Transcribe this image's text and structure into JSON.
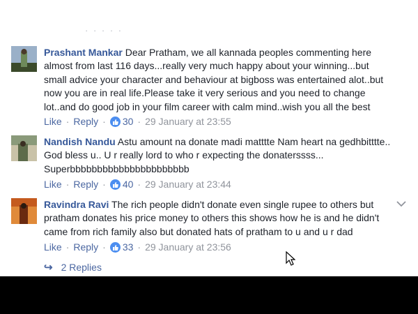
{
  "comments": [
    {
      "author": "Prashant Mankar",
      "text": "Dear Pratham, we all kannada peoples commenting here almost from last 116 days...really very much happy about your winning...but small advice your character and behaviour at bigboss was entertained alot..but now you are in real life.Please take it very serious and you need to change lot..and do good job in your film career with calm mind..wish you all the best",
      "like_label": "Like",
      "reply_label": "Reply",
      "likes": "30",
      "time": "29 January at 23:55",
      "avatar_colors": [
        "#9ab0c8",
        "#6e8a5a",
        "#3b4a2a"
      ]
    },
    {
      "author": "Nandish Nandu",
      "text": "Astu amount na donate madi matttte Nam heart na gedhbitttte.. God bless u.. U r really lord to who r expecting the donaterssss... Superbbbbbbbbbbbbbbbbbbbbbb",
      "like_label": "Like",
      "reply_label": "Reply",
      "likes": "40",
      "time": "29 January at 23:44",
      "avatar_colors": [
        "#8a9a7a",
        "#5d6b4a",
        "#c9c2a8"
      ]
    },
    {
      "author": "Ravindra Ravi",
      "text": "The rich people didn't donate even single rupee to others but pratham donates his price money to others this shows how he is and he didn't came from rich family also but donated hats of pratham to u and u r dad",
      "like_label": "Like",
      "reply_label": "Reply",
      "likes": "33",
      "time": "29 January at 23:56",
      "avatar_colors": [
        "#c45a1e",
        "#e08a3a",
        "#6a2a10"
      ]
    }
  ],
  "replies_label": "2 Replies",
  "theme": {
    "link_color": "#4b67a1",
    "author_color": "#365899",
    "like_badge_color": "#4c8ef0"
  }
}
